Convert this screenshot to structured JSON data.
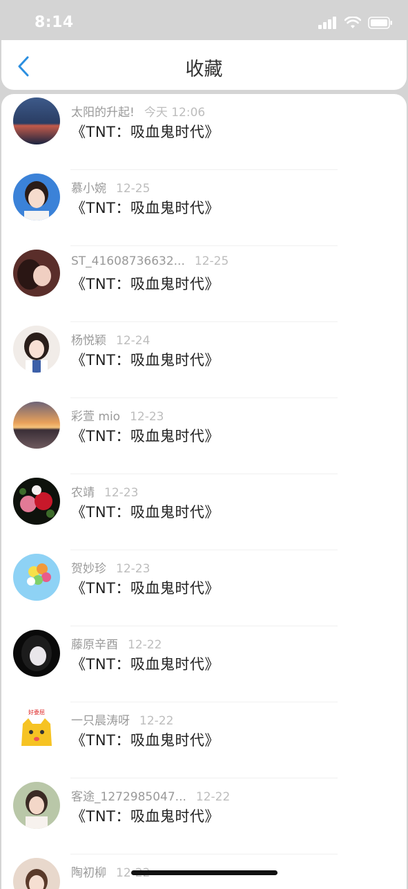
{
  "status": {
    "time": "8:14"
  },
  "nav": {
    "title": "收藏"
  },
  "items": [
    {
      "user": "太阳的升起!",
      "time": "今天 12:06",
      "title": "《TNT：吸血鬼时代》",
      "avatar": "sunset-dark-avatar"
    },
    {
      "user": "慕小婉",
      "time": "12-25",
      "title": "《TNT：吸血鬼时代》",
      "avatar": "girl-blue-bg-avatar"
    },
    {
      "user": "ST_41608736632...",
      "time": "12-25",
      "title": "《TNT：吸血鬼时代》",
      "avatar": "girl-dark-avatar"
    },
    {
      "user": "杨悦颖",
      "time": "12-24",
      "title": "《TNT：吸血鬼时代》",
      "avatar": "girl-light-avatar"
    },
    {
      "user": "彩萱 mio",
      "time": "12-23",
      "title": "《TNT：吸血鬼时代》",
      "avatar": "sunset-lake-avatar"
    },
    {
      "user": "农靖",
      "time": "12-23",
      "title": "《TNT：吸血鬼时代》",
      "avatar": "roses-avatar"
    },
    {
      "user": "贺妙珍",
      "time": "12-23",
      "title": "《TNT：吸血鬼时代》",
      "avatar": "balloons-avatar"
    },
    {
      "user": "藤原辛酉",
      "time": "12-22",
      "title": "《TNT：吸血鬼时代》",
      "avatar": "anime-girl-avatar"
    },
    {
      "user": "一只晨涛呀",
      "time": "12-22",
      "title": "《TNT：吸血鬼时代》",
      "avatar": "cartoon-cat-avatar",
      "avatar_badge": "好委屈"
    },
    {
      "user": "客途_1272985047...",
      "time": "12-22",
      "title": "《TNT：吸血鬼时代》",
      "avatar": "girl-outdoor-avatar"
    },
    {
      "user": "陶初柳",
      "time": "12-22",
      "title": "",
      "avatar": "girl-partial-avatar"
    }
  ]
}
